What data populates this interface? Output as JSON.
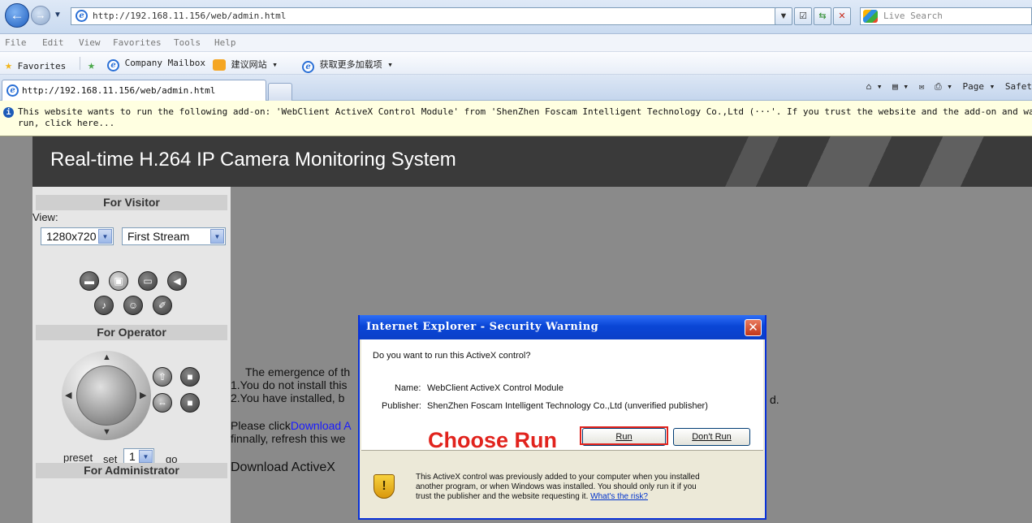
{
  "browser": {
    "url": "http://192.168.11.156/web/admin.html",
    "nav_back": "←",
    "nav_forward": "→",
    "nav_dropdown": "▼",
    "search_placeholder": "Live Search",
    "toolbar_buttons": [
      "▼",
      "☑",
      "⇆",
      "✕"
    ],
    "menu": [
      "File",
      "Edit",
      "View",
      "Favorites",
      "Tools",
      "Help"
    ],
    "favorites": {
      "label": "Favorites",
      "items": [
        "Company Mailbox",
        "建议网站 ▾",
        "获取更多加载项 ▾"
      ]
    },
    "tab_title": "http://192.168.11.156/web/admin.html",
    "command_bar": [
      "⌂ ▾",
      "▤ ▾",
      "✉",
      "⎙ ▾",
      "Page ▾",
      "Safet"
    ],
    "info_bar": {
      "line1": "This website wants to run the following add-on: 'WebClient ActiveX Control Module' from 'ShenZhen Foscam Intelligent Technology Co.,Ltd (···'. If you trust the website and the add-on and want to",
      "line2": "run, click here..."
    }
  },
  "page": {
    "title": "Real-time H.264 IP Camera Monitoring System",
    "visitor": {
      "header": "For Visitor",
      "view_label": "View:",
      "resolution": "1280x720",
      "stream": "First Stream",
      "icons_row1": [
        "▬",
        "▣",
        "▭",
        "◀"
      ],
      "icons_row2": [
        "♪",
        "☺",
        "✐"
      ]
    },
    "operator": {
      "header": "For Operator",
      "ptz_arrows": [
        "▲",
        "▼",
        "◀",
        "▶"
      ],
      "side_buttons": [
        "⇧",
        "■",
        "⇔",
        "■"
      ],
      "preset_label": "preset",
      "set_label": "set",
      "preset_value": "1",
      "go_label": "go"
    },
    "admin_header": "For Administrator",
    "main_text": {
      "line1": "The emergence of th",
      "line2": "1.You do not install this",
      "line3": "2.You have installed, b",
      "line3_tail": "d.",
      "line4_prefix": "Please click",
      "line4_link": "Download A",
      "line5": "finnally, refresh this we",
      "download": "Download ActiveX"
    }
  },
  "dialog": {
    "title": "Internet Explorer - Security Warning",
    "close": "✕",
    "question": "Do you want to run this ActiveX control?",
    "name_label": "Name:",
    "name_value": "WebClient ActiveX Control Module",
    "publisher_label": "Publisher:",
    "publisher_value": "ShenZhen Foscam Intelligent Technology Co.,Ltd (unverified publisher)",
    "run_button": "Run",
    "dont_run_button": "Don't Run",
    "warning_icon": "!",
    "warning_line1": "This ActiveX control was previously added to your computer when you installed",
    "warning_line2": "another program, or when Windows was installed. You should only run it if you",
    "warning_line3": "trust the publisher and the website requesting it.",
    "risk_link": "What's the risk?"
  },
  "annotation": {
    "text": "Choose Run",
    "color": "#e1231d"
  }
}
